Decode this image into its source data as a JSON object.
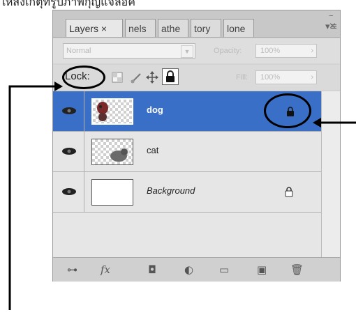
{
  "caption": "ให้สังเกตุที่รูปภาพกุญแจล็อค",
  "panel": {
    "tabs": [
      "Layers ×",
      "nels",
      "athe",
      "tory",
      "lone"
    ],
    "close_glyph": "×",
    "menu_glyph": "▾≡",
    "blend_mode": "Normal",
    "opacity_label": "Opacity:",
    "opacity_value": "100%",
    "lock_label": "Lock:",
    "fill_label": "Fill:",
    "fill_value": "100%",
    "layers": [
      {
        "name": "dog",
        "selected": true,
        "locked": true
      },
      {
        "name": "cat",
        "selected": false,
        "locked": false
      },
      {
        "name": "Background",
        "selected": false,
        "locked": true
      }
    ],
    "bottom_icons": [
      "link-layers-icon",
      "fx-icon",
      "add-mask-icon",
      "adjustment-layer-icon",
      "new-group-icon",
      "new-layer-icon",
      "delete-layer-icon"
    ],
    "fx_label": "fx"
  },
  "annotation_color": "#000000"
}
